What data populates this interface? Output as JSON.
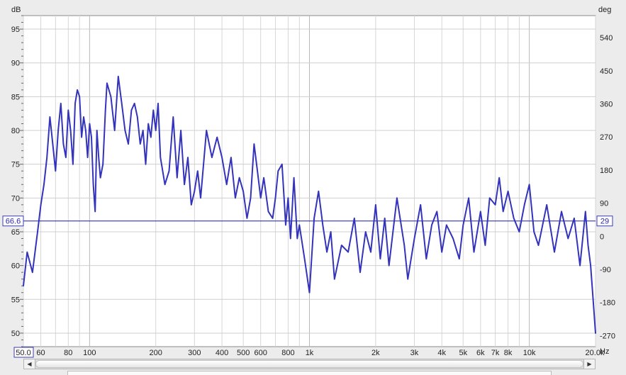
{
  "chart_data": {
    "type": "line",
    "title": "",
    "xlabel": "Hz",
    "ylabel": "dB",
    "y2label": "deg",
    "xscale": "log",
    "xlim": [
      50,
      20000
    ],
    "ylim": [
      48,
      97
    ],
    "y2lim": [
      -300,
      600
    ],
    "grid": true,
    "x_tick_labels": [
      "50.0",
      "60",
      "80",
      "100",
      "200",
      "300",
      "400",
      "500",
      "600",
      "800",
      "1k",
      "2k",
      "3k",
      "4k",
      "5k",
      "6k",
      "7k",
      "8k",
      "10k",
      "20.0k"
    ],
    "y_tick_labels": [
      "95",
      "90",
      "85",
      "80",
      "75",
      "70",
      "65",
      "60",
      "55",
      "50"
    ],
    "y2_tick_labels": [
      "540",
      "450",
      "360",
      "270",
      "180",
      "90",
      "0",
      "-90",
      "-180",
      "-270"
    ],
    "cursor": {
      "left_value": "66.6",
      "right_value": "29"
    },
    "series": [
      {
        "color": "#3333bb",
        "x": [
          50,
          52,
          55,
          58,
          60,
          62,
          64,
          66,
          68,
          70,
          72,
          74,
          76,
          78,
          80,
          82,
          84,
          86,
          88,
          90,
          92,
          94,
          96,
          98,
          100,
          102,
          104,
          106,
          108,
          110,
          112,
          115,
          118,
          120,
          125,
          130,
          135,
          140,
          145,
          150,
          155,
          160,
          165,
          170,
          175,
          180,
          185,
          190,
          195,
          200,
          205,
          210,
          220,
          230,
          240,
          250,
          260,
          270,
          280,
          290,
          300,
          310,
          320,
          340,
          360,
          380,
          400,
          420,
          440,
          460,
          480,
          500,
          520,
          540,
          560,
          580,
          600,
          620,
          650,
          680,
          700,
          720,
          750,
          780,
          800,
          820,
          850,
          880,
          900,
          950,
          1000,
          1050,
          1100,
          1150,
          1200,
          1250,
          1300,
          1400,
          1500,
          1600,
          1700,
          1800,
          1900,
          2000,
          2100,
          2200,
          2300,
          2500,
          2700,
          2800,
          3000,
          3200,
          3400,
          3600,
          3800,
          4000,
          4200,
          4500,
          4800,
          5000,
          5300,
          5600,
          6000,
          6300,
          6600,
          7000,
          7300,
          7600,
          8000,
          8500,
          9000,
          9500,
          10000,
          10500,
          11000,
          12000,
          13000,
          14000,
          15000,
          16000,
          17000,
          18000,
          18500,
          19000,
          19500,
          20000
        ],
        "values": [
          57,
          62,
          59,
          65,
          69,
          72,
          76,
          82,
          78,
          74,
          80,
          84,
          78,
          76,
          83,
          80,
          75,
          84,
          86,
          85,
          79,
          82,
          80,
          76,
          81,
          79,
          72,
          68,
          80,
          76,
          73,
          75,
          83,
          87,
          85,
          80,
          88,
          84,
          80,
          78,
          83,
          84,
          82,
          78,
          80,
          75,
          81,
          79,
          83,
          80,
          84,
          76,
          72,
          74,
          82,
          73,
          80,
          72,
          76,
          69,
          71,
          74,
          70,
          80,
          76,
          79,
          76,
          72,
          76,
          70,
          73,
          71,
          67,
          70,
          78,
          74,
          70,
          73,
          68,
          67,
          70,
          74,
          75,
          66,
          70,
          64,
          73,
          64,
          66,
          61,
          56,
          67,
          71,
          66,
          62,
          65,
          58,
          63,
          62,
          67,
          59,
          65,
          62,
          69,
          61,
          67,
          60,
          70,
          63,
          58,
          64,
          69,
          61,
          66,
          68,
          62,
          66,
          64,
          61,
          66,
          70,
          62,
          68,
          63,
          70,
          69,
          73,
          68,
          71,
          67,
          65,
          69,
          72,
          65,
          63,
          69,
          62,
          68,
          64,
          67,
          60,
          68,
          63,
          60,
          55,
          50
        ]
      }
    ]
  }
}
